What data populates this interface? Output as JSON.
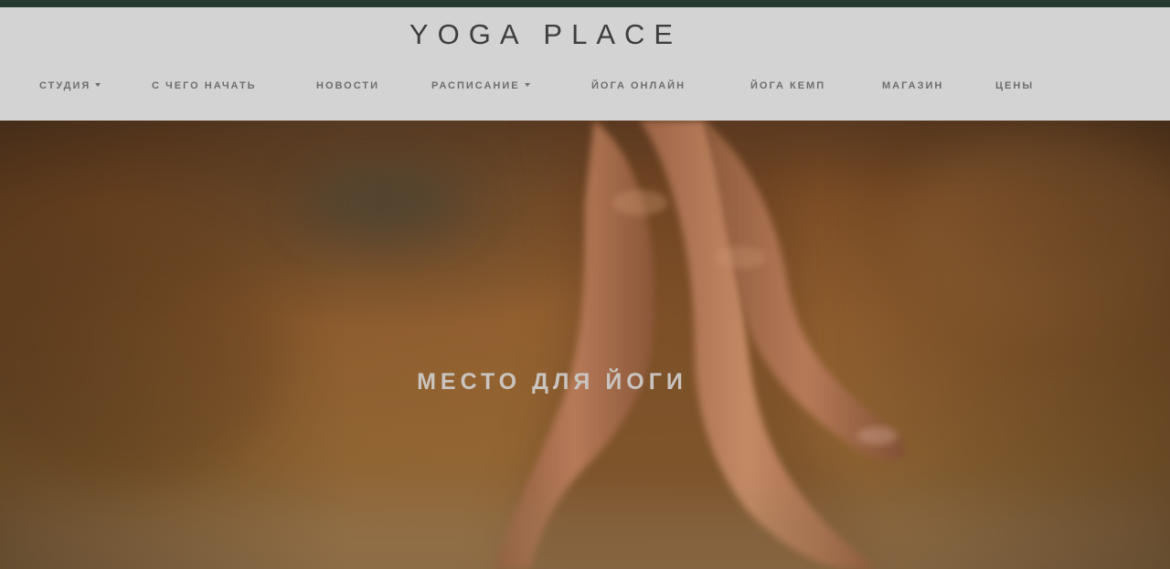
{
  "header": {
    "logo": "YOGA PLACE"
  },
  "nav": {
    "items": [
      {
        "label": "СТУДИЯ",
        "dropdown": true
      },
      {
        "label": "С ЧЕГО НАЧАТЬ",
        "dropdown": false
      },
      {
        "label": "НОВОСТИ",
        "dropdown": false
      },
      {
        "label": "РАСПИСАНИЕ",
        "dropdown": true
      },
      {
        "label": "ЙОГА ОНЛАЙН",
        "dropdown": false
      },
      {
        "label": "ЙОГА КЕМП",
        "dropdown": false
      },
      {
        "label": "МАГАЗИН",
        "dropdown": false
      },
      {
        "label": "ЦЕНЫ",
        "dropdown": false
      }
    ]
  },
  "hero": {
    "title": "МЕСТО ДЛЯ ЙОГИ",
    "image": "hand-fingers-walking-photo"
  },
  "colors": {
    "top_strip": "#243a31",
    "header_bg": "#d3d3d3",
    "nav_text": "#6e6e6e",
    "logo_text": "#3e3e3e",
    "hero_text": "#c9c4bf"
  }
}
